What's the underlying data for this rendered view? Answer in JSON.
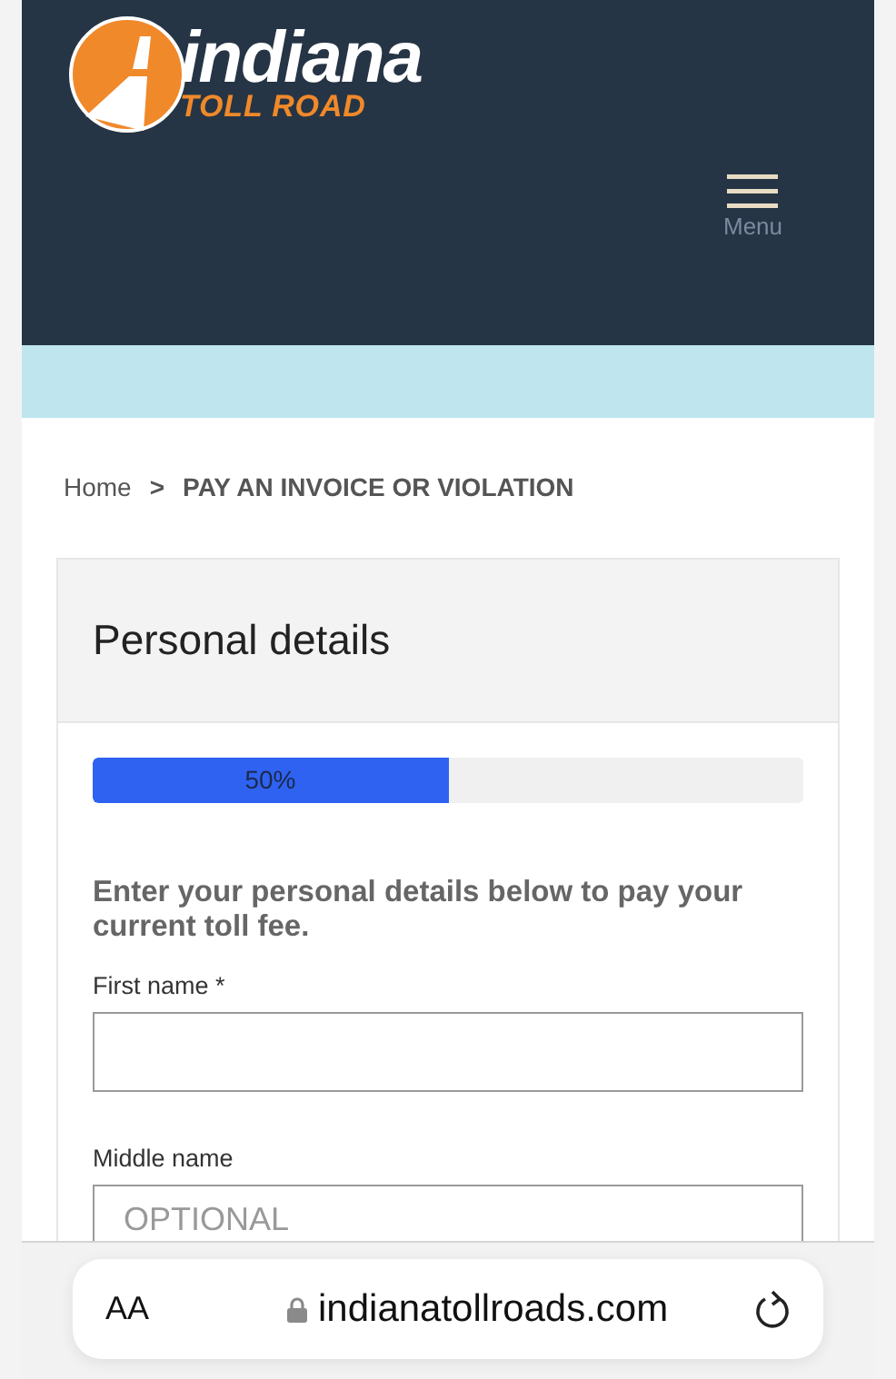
{
  "header": {
    "logo": {
      "word": "indiana",
      "subtitle": "TOLL ROAD"
    },
    "menu_label": "Menu"
  },
  "breadcrumb": [
    {
      "label": "Home",
      "current": false
    },
    {
      "label": "PAY AN INVOICE OR VIOLATION",
      "current": true
    }
  ],
  "breadcrumb_separator": ">",
  "card": {
    "title": "Personal details",
    "progress": {
      "level": 0.5,
      "reading": "50%"
    },
    "instruction": "Enter your personal details below to pay your current toll fee.",
    "fields": [
      {
        "label": "First name *"
      },
      {
        "label": "Middle name",
        "placeholder": "OPTIONAL"
      }
    ]
  },
  "browser_bar": {
    "text_size_label": "AA",
    "url": "indianatollroads.com"
  }
}
